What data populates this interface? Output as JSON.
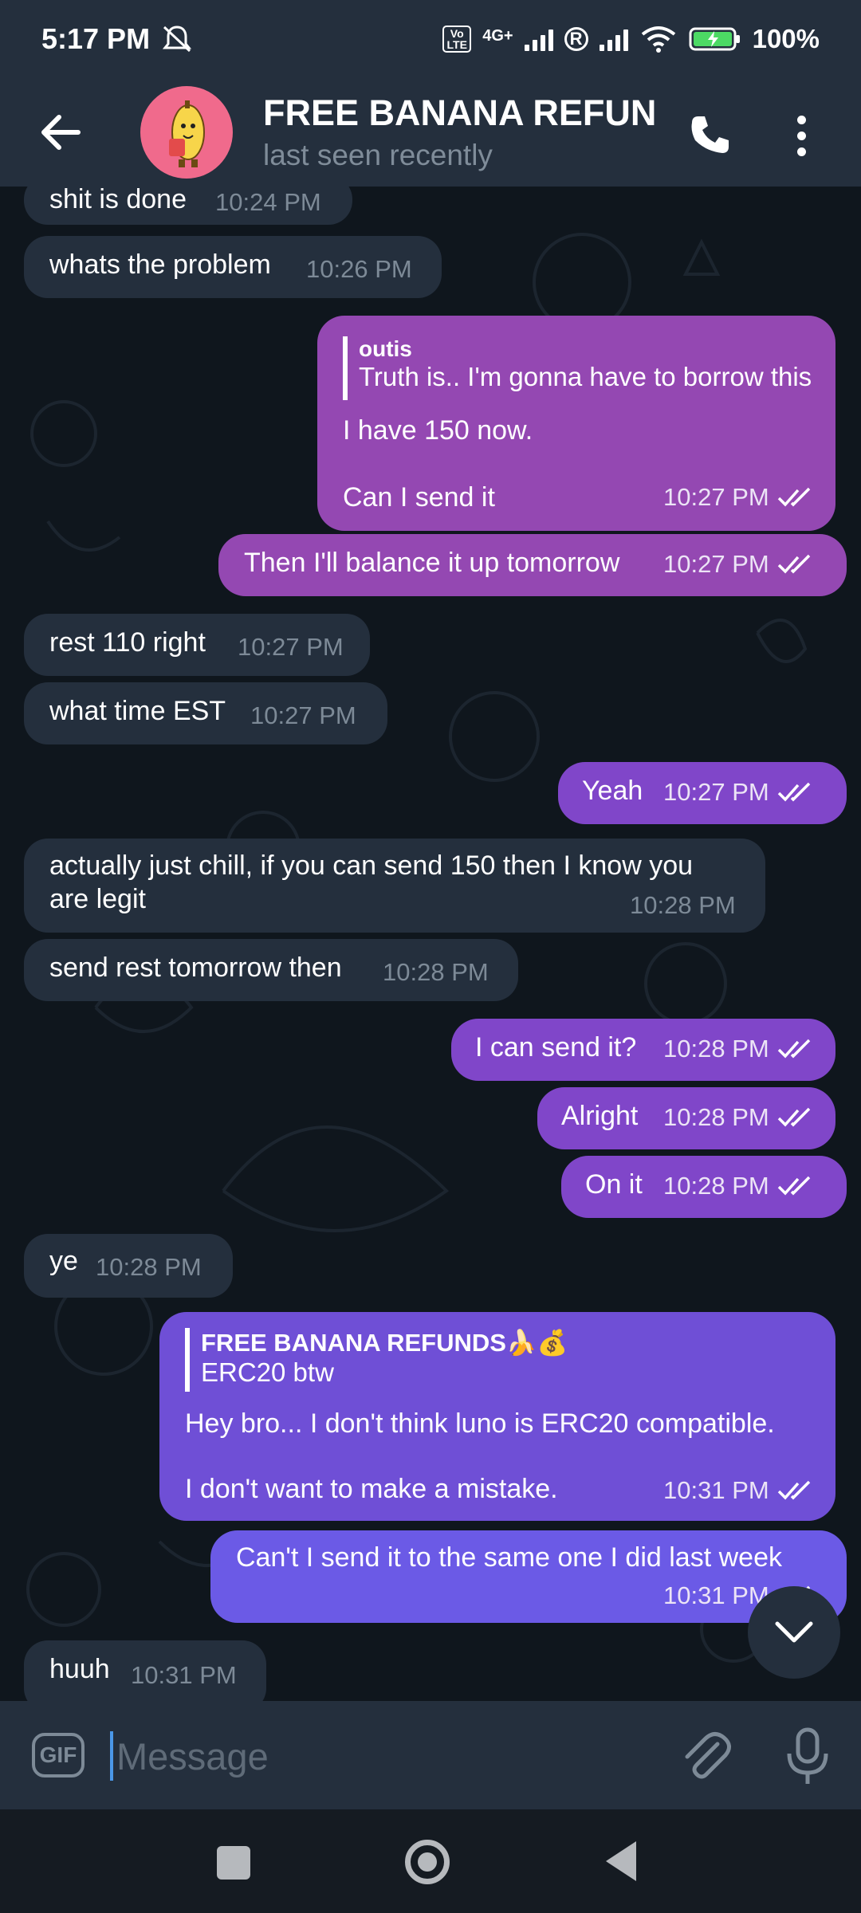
{
  "status_bar": {
    "time": "5:17 PM",
    "network_label": "4G+",
    "volte_label": "Vo LTE",
    "roaming_label": "R",
    "battery_percent": "100%"
  },
  "header": {
    "title": "FREE BANANA REFUN",
    "subtitle": "last seen recently"
  },
  "messages": [
    {
      "dir": "in",
      "text": "shit is done",
      "time": "10:24 PM"
    },
    {
      "dir": "in",
      "text": "whats the problem",
      "time": "10:26 PM"
    },
    {
      "dir": "out",
      "reply_name": "outis",
      "reply_text": "Truth is.. I'm gonna have to borrow this",
      "text_line1": "I have 150 now.",
      "text_line2": "Can I send it",
      "time": "10:27 PM"
    },
    {
      "dir": "out",
      "text": "Then I'll balance it up tomorrow",
      "time": "10:27 PM"
    },
    {
      "dir": "in",
      "text": "rest 110 right",
      "time": "10:27 PM"
    },
    {
      "dir": "in",
      "text": "what time EST",
      "time": "10:27 PM"
    },
    {
      "dir": "out",
      "text": "Yeah",
      "time": "10:27 PM"
    },
    {
      "dir": "in",
      "text_line1": "actually just chill, if you can send 150 then I know you",
      "text_line2": "are legit",
      "time": "10:28 PM"
    },
    {
      "dir": "in",
      "text": "send rest tomorrow then",
      "time": "10:28 PM"
    },
    {
      "dir": "out",
      "text": "I can send it?",
      "time": "10:28 PM"
    },
    {
      "dir": "out",
      "text": "Alright",
      "time": "10:28 PM"
    },
    {
      "dir": "out",
      "text": "On it",
      "time": "10:28 PM"
    },
    {
      "dir": "in",
      "text": "ye",
      "time": "10:28 PM"
    },
    {
      "dir": "out",
      "reply_name": "FREE BANANA REFUNDS🍌💰",
      "reply_text": "ERC20 btw",
      "text_line1": "Hey bro... I don't think luno is ERC20 compatible.",
      "text_line2": "I don't want to make a mistake.",
      "time": "10:31 PM"
    },
    {
      "dir": "out",
      "text": "Can't I send it to the same one I did last week",
      "time": "10:31 PM"
    },
    {
      "dir": "in",
      "text": "huuh",
      "time": "10:31 PM"
    }
  ],
  "input": {
    "gif_label": "GIF",
    "placeholder": "Message"
  },
  "colors": {
    "header_bg": "#242f3d",
    "incoming_bubble": "#242f3d",
    "outgoing_purple": "#9448b2",
    "outgoing_violet": "#6f4fd6",
    "outgoing_blue": "#6b5ae6",
    "caret": "#4b97e8"
  }
}
